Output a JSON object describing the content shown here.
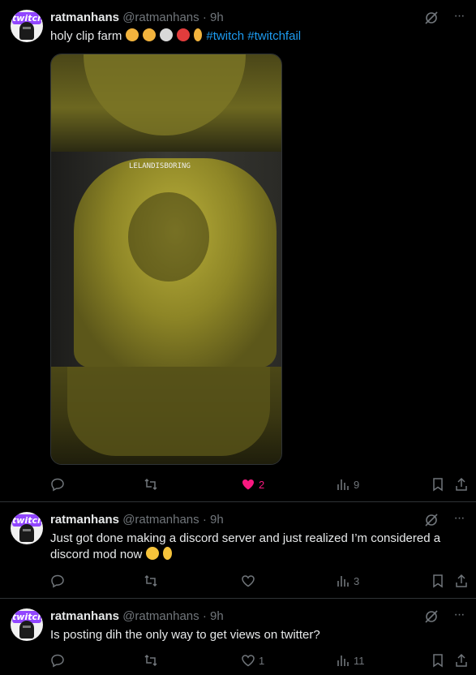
{
  "tweets": [
    {
      "name": "ratmanhans",
      "handle": "@ratmanhans",
      "sep": "·",
      "time": "9h",
      "text": "holy clip farm",
      "hashtags": [
        "#twitch",
        "#twitchfail"
      ],
      "media_caption": "LELANDISBORING",
      "actions": {
        "reply": "",
        "repost": "",
        "like": "2",
        "views": "9"
      }
    },
    {
      "name": "ratmanhans",
      "handle": "@ratmanhans",
      "sep": "·",
      "time": "9h",
      "text": "Just got done making a discord server and just realized I’m considered a discord mod now",
      "actions": {
        "reply": "",
        "repost": "",
        "like": "",
        "views": "3"
      }
    },
    {
      "name": "ratmanhans",
      "handle": "@ratmanhans",
      "sep": "·",
      "time": "9h",
      "text": "Is posting dih the only way to get views on twitter?",
      "actions": {
        "reply": "",
        "repost": "",
        "like": "1",
        "views": "11"
      }
    }
  ],
  "avatar_logo": "twitch",
  "colors": {
    "accent": "#1d9bf0",
    "like": "#f91880",
    "muted": "#71767b",
    "bg": "#000000"
  },
  "icons": [
    "grok-icon",
    "more-icon",
    "reply-icon",
    "repost-icon",
    "like-icon",
    "views-icon",
    "bookmark-icon",
    "share-icon"
  ]
}
